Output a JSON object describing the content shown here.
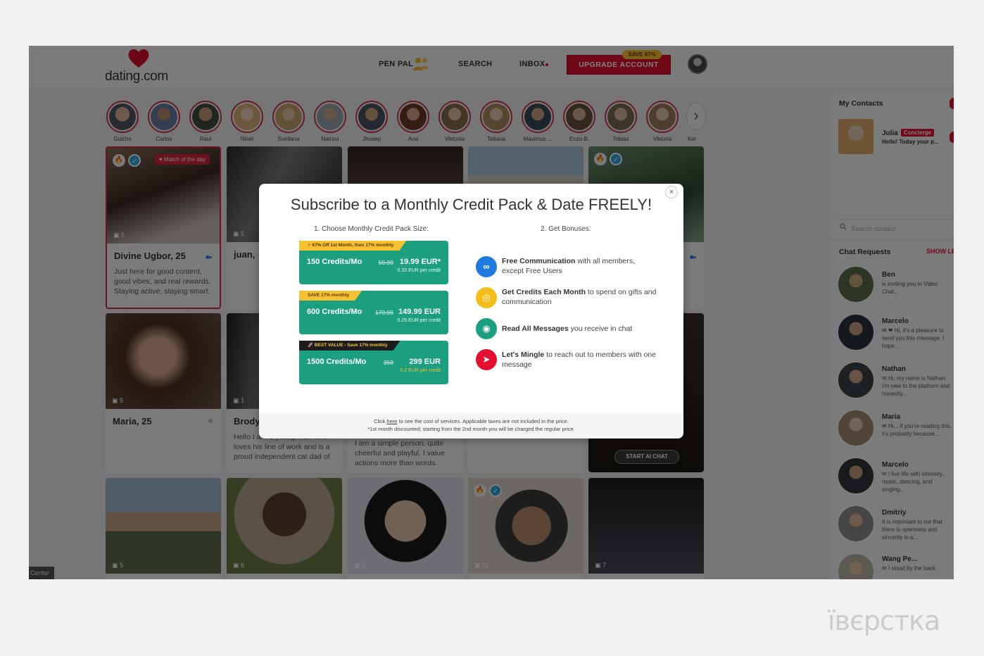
{
  "header": {
    "logo": "dating.com",
    "nav": {
      "penpal": "PEN PAL",
      "search": "SEARCH",
      "inbox": "INBOX"
    },
    "upgrade_label": "UPGRADE ACCOUNT",
    "save_badge": "SAVE 67%"
  },
  "stories": [
    "Guicho",
    "Carlos",
    "Raul",
    "Ninel",
    "Svetlana",
    "Nairovi",
    "Jhosep",
    "Ana",
    "Viktoriia",
    "Tetiana",
    "Maximus ...",
    "Enzo B.",
    "Tobias",
    "Viktoria",
    "Ker"
  ],
  "cards": {
    "divine": {
      "match_badge": "♥ Match of the day",
      "photos": "5",
      "name": "Divine Ugbor, 25",
      "bio": "Just here for good content, good vibes, and real rewards. Staying active, staying smart."
    },
    "juan": {
      "photos": "5",
      "name": "juan,"
    },
    "maria": {
      "photos": "5",
      "name": "Maria, 25"
    },
    "brody": {
      "photos": "1",
      "name": "Brody",
      "bio": "Hello I am a young man who loves his line of work and is a proud independent cat dad of"
    },
    "card7": {
      "bio": "I am a simple person, quite cheerful and playful. I value actions more than words."
    },
    "ai": {
      "label": "START AI CHAT"
    },
    "row3": [
      "5",
      "6",
      "3",
      "11",
      "7"
    ]
  },
  "sidebar": {
    "contacts_title": "My Contacts",
    "contact": {
      "name": "Julia",
      "badge": "Concierge",
      "msg": "Hello! Today your p..."
    },
    "search_placeholder": "Search contact",
    "requests_title": "Chat Requests",
    "show_less": "SHOW LESS",
    "requests": [
      {
        "name": "Ben",
        "msg": "is inviting you to Video Chat..."
      },
      {
        "name": "Marcelo",
        "msg": "✉ ❤ Hi, it's a pleasure to send you this message. I hope..."
      },
      {
        "name": "Nathan",
        "msg": "✉ Hi, my name is Nathan. I'm new to the platform and honestly..."
      },
      {
        "name": "Maria",
        "msg": "✉ Hi... if you're reading this, it's probably because..."
      },
      {
        "name": "Marcelo",
        "msg": "✉ I live life with intensity... music, dancing, and singing..."
      },
      {
        "name": "Dmitriy",
        "msg": "It is important to me that there is openness and sincerity in a..."
      },
      {
        "name": "Wang Pe...",
        "msg": "✉ I stood by the back"
      }
    ],
    "center_tab": "Center"
  },
  "modal": {
    "title": "Subscribe to a Monthly Credit Pack & Date FREELY!",
    "step1": "1. Choose Monthly Credit Pack Size:",
    "step2": "2. Get Bonuses:",
    "packs": [
      {
        "tag": "⚡ 67% Off 1st Month, then 17% monthly",
        "credits": "150 Credits/Mo",
        "old": "59.99",
        "price": "19.99 EUR*",
        "per": "0.33 EUR per credit"
      },
      {
        "tag": "SAVE 17% monthly",
        "credits": "600 Credits/Mo",
        "old": "179.99",
        "price": "149.99 EUR",
        "per": "0.25 EUR per credit"
      },
      {
        "tag": "🚀 BEST VALUE - Save 17% monthly",
        "credits": "1500 Credits/Mo",
        "old": "359",
        "price": "299 EUR",
        "per": "0.2 EUR per credit"
      }
    ],
    "bonuses": [
      {
        "bold": "Free Communication",
        "rest": " with all members, except Free Users",
        "color": "#1f7ae0"
      },
      {
        "bold": "Get Credits Each Month",
        "rest": " to spend on gifts and communication",
        "color": "#f3be1c"
      },
      {
        "bold": "Read All Messages",
        "rest": " you receive in chat",
        "color": "#1c9f7e"
      },
      {
        "bold": "Let's Mingle",
        "rest": " to reach out to members with one message",
        "color": "#e0102e"
      }
    ],
    "foot_click": "Click ",
    "foot_link": "here",
    "foot_rest": " to see the cost of services. Applicable taxes are not included in the price.",
    "foot2": "*1st month discounted; starting from the 2nd month you will be charged the regular price."
  },
  "watermark": "ївєрстка",
  "colors": {
    "accent": "#e0102e",
    "pack": "#1c9f7e",
    "save": "#f6c233"
  }
}
